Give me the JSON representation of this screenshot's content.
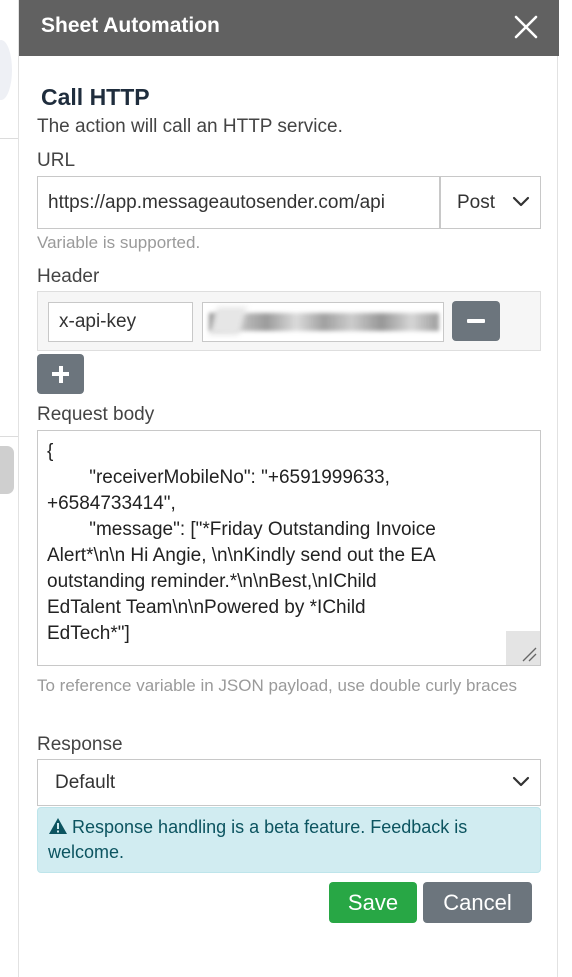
{
  "dialog": {
    "title": "Sheet Automation"
  },
  "action": {
    "heading": "Call HTTP",
    "description": "The action will call an HTTP service."
  },
  "url": {
    "label": "URL",
    "value": "https://app.messageautosender.com/api",
    "method": "Post",
    "hint": "Variable is supported."
  },
  "header": {
    "label": "Header",
    "rows": [
      {
        "key": "x-api-key",
        "value": "redacted"
      }
    ]
  },
  "request_body": {
    "label": "Request body",
    "value": "{\n        \"receiverMobileNo\": \"+6591999633,\n+6584733414\",\n        \"message\": [\"*Friday Outstanding Invoice\nAlert*\\n\\n Hi Angie, \\n\\nKindly send out the EA\noutstanding reminder.*\\n\\nBest,\\nIChild\nEdTalent Team\\n\\nPowered by *IChild\nEdTech*\"]",
    "hint": "To reference variable in JSON payload, use double curly braces"
  },
  "response": {
    "label": "Response",
    "selected": "Default",
    "alert": "Response handling is a beta feature. Feedback is welcome."
  },
  "buttons": {
    "save": "Save",
    "cancel": "Cancel"
  },
  "icons": {
    "close": "close-icon",
    "chevron": "chevron-down-icon",
    "warning": "warning-icon",
    "minus": "minus-icon",
    "plus": "plus-icon"
  },
  "colors": {
    "titlebar": "#616161",
    "save": "#28a745",
    "secondary": "#6c757d",
    "alert_bg": "#d1ecf1"
  }
}
